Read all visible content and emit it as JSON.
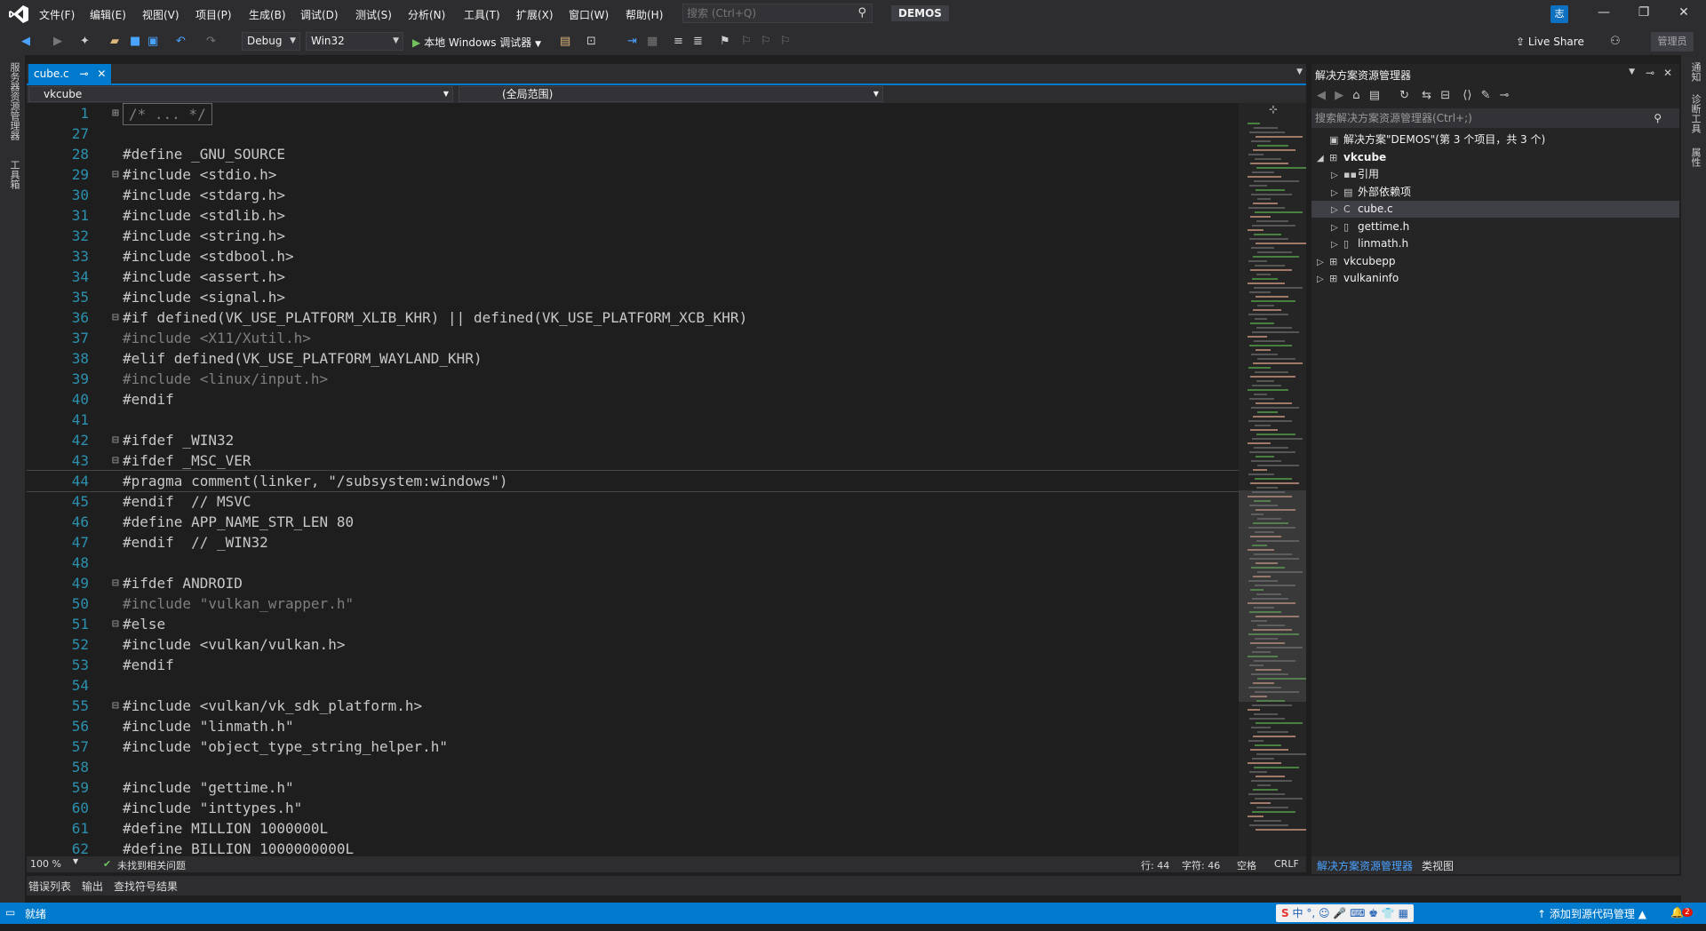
{
  "menu": {
    "items": [
      "文件(F)",
      "编辑(E)",
      "视图(V)",
      "项目(P)",
      "生成(B)",
      "调试(D)",
      "测试(S)",
      "分析(N)",
      "工具(T)",
      "扩展(X)",
      "窗口(W)",
      "帮助(H)"
    ],
    "search_placeholder": "搜索 (Ctrl+Q)",
    "solution_name": "DEMOS",
    "user_initial": "志"
  },
  "toolbar": {
    "config": "Debug",
    "platform": "Win32",
    "run_label": "本地 Windows 调试器",
    "live_share": "Live Share",
    "admin": "管理员"
  },
  "left_strip": {
    "items": [
      "服务器资源管理器",
      "工具箱"
    ]
  },
  "right_strip": {
    "items": [
      "通知",
      "诊断工具",
      "属性"
    ]
  },
  "editor": {
    "tab_name": "cube.c",
    "nav_project": "vkcube",
    "nav_scope": "(全局范围)",
    "lines": [
      {
        "n": "1",
        "fold": "⊞",
        "text": "/* ... */",
        "cls": "dim"
      },
      {
        "n": "27",
        "fold": "",
        "text": "",
        "cls": ""
      },
      {
        "n": "28",
        "fold": "",
        "text": "#define _GNU_SOURCE",
        "cls": "pp"
      },
      {
        "n": "29",
        "fold": "⊟",
        "text": "#include <stdio.h>",
        "cls": "pp"
      },
      {
        "n": "30",
        "fold": "",
        "text": "#include <stdarg.h>",
        "cls": "pp"
      },
      {
        "n": "31",
        "fold": "",
        "text": "#include <stdlib.h>",
        "cls": "pp"
      },
      {
        "n": "32",
        "fold": "",
        "text": "#include <string.h>",
        "cls": "pp"
      },
      {
        "n": "33",
        "fold": "",
        "text": "#include <stdbool.h>",
        "cls": "pp"
      },
      {
        "n": "34",
        "fold": "",
        "text": "#include <assert.h>",
        "cls": "pp"
      },
      {
        "n": "35",
        "fold": "",
        "text": "#include <signal.h>",
        "cls": "pp"
      },
      {
        "n": "36",
        "fold": "⊟",
        "text": "#if defined(VK_USE_PLATFORM_XLIB_KHR) || defined(VK_USE_PLATFORM_XCB_KHR)",
        "cls": "pp"
      },
      {
        "n": "37",
        "fold": "",
        "text": "#include <X11/Xutil.h>",
        "cls": "dim"
      },
      {
        "n": "38",
        "fold": "",
        "text": "#elif defined(VK_USE_PLATFORM_WAYLAND_KHR)",
        "cls": "pp"
      },
      {
        "n": "39",
        "fold": "",
        "text": "#include <linux/input.h>",
        "cls": "dim"
      },
      {
        "n": "40",
        "fold": "",
        "text": "#endif",
        "cls": "pp"
      },
      {
        "n": "41",
        "fold": "",
        "text": "",
        "cls": ""
      },
      {
        "n": "42",
        "fold": "⊟",
        "text": "#ifdef _WIN32",
        "cls": "pp"
      },
      {
        "n": "43",
        "fold": "⊟",
        "text": "#ifdef _MSC_VER",
        "cls": "pp"
      },
      {
        "n": "44",
        "fold": "",
        "text": "#pragma comment(linker, \"/subsystem:windows\")",
        "cls": "pp"
      },
      {
        "n": "45",
        "fold": "",
        "text": "#endif  // MSVC",
        "cls": "pp"
      },
      {
        "n": "46",
        "fold": "",
        "text": "#define APP_NAME_STR_LEN 80",
        "cls": "pp"
      },
      {
        "n": "47",
        "fold": "",
        "text": "#endif  // _WIN32",
        "cls": "pp"
      },
      {
        "n": "48",
        "fold": "",
        "text": "",
        "cls": ""
      },
      {
        "n": "49",
        "fold": "⊟",
        "text": "#ifdef ANDROID",
        "cls": "pp"
      },
      {
        "n": "50",
        "fold": "",
        "text": "#include \"vulkan_wrapper.h\"",
        "cls": "dim"
      },
      {
        "n": "51",
        "fold": "⊟",
        "text": "#else",
        "cls": "pp"
      },
      {
        "n": "52",
        "fold": "",
        "text": "#include <vulkan/vulkan.h>",
        "cls": "pp"
      },
      {
        "n": "53",
        "fold": "",
        "text": "#endif",
        "cls": "pp"
      },
      {
        "n": "54",
        "fold": "",
        "text": "",
        "cls": ""
      },
      {
        "n": "55",
        "fold": "⊟",
        "text": "#include <vulkan/vk_sdk_platform.h>",
        "cls": "pp"
      },
      {
        "n": "56",
        "fold": "",
        "text": "#include \"linmath.h\"",
        "cls": "pp"
      },
      {
        "n": "57",
        "fold": "",
        "text": "#include \"object_type_string_helper.h\"",
        "cls": "pp"
      },
      {
        "n": "58",
        "fold": "",
        "text": "",
        "cls": ""
      },
      {
        "n": "59",
        "fold": "",
        "text": "#include \"gettime.h\"",
        "cls": "pp"
      },
      {
        "n": "60",
        "fold": "",
        "text": "#include \"inttypes.h\"",
        "cls": "pp"
      },
      {
        "n": "61",
        "fold": "",
        "text": "#define MILLION 1000000L",
        "cls": "pp"
      },
      {
        "n": "62",
        "fold": "",
        "text": "#define BILLION 1000000000L",
        "cls": "pp"
      }
    ],
    "zoom": "100 %",
    "issues": "未找到相关问题",
    "row": "行: 44",
    "col": "字符: 46",
    "spaces": "空格",
    "eol": "CRLF"
  },
  "solution_explorer": {
    "title": "解决方案资源管理器",
    "search_placeholder": "搜索解决方案资源管理器(Ctrl+;)",
    "tree": [
      {
        "label": "解决方案\"DEMOS\"(第 3 个项目，共 3 个)",
        "depth": 0,
        "exp": "",
        "icon": "▣",
        "bold": false
      },
      {
        "label": "vkcube",
        "depth": 0,
        "exp": "◢",
        "icon": "⊞",
        "bold": true
      },
      {
        "label": "引用",
        "depth": 1,
        "exp": "▷",
        "icon": "▪▪",
        "bold": false
      },
      {
        "label": "外部依赖项",
        "depth": 1,
        "exp": "▷",
        "icon": "▤",
        "bold": false
      },
      {
        "label": "cube.c",
        "depth": 1,
        "exp": "▷",
        "icon": "C",
        "bold": false
      },
      {
        "label": "gettime.h",
        "depth": 1,
        "exp": "▷",
        "icon": "▯",
        "bold": false
      },
      {
        "label": "linmath.h",
        "depth": 1,
        "exp": "▷",
        "icon": "▯",
        "bold": false
      },
      {
        "label": "vkcubepp",
        "depth": 0,
        "exp": "▷",
        "icon": "⊞",
        "bold": false
      },
      {
        "label": "vulkaninfo",
        "depth": 0,
        "exp": "▷",
        "icon": "⊞",
        "bold": false
      }
    ],
    "tabs": [
      "解决方案资源管理器",
      "类视图"
    ]
  },
  "bottom_tabs": [
    "错误列表",
    "输出",
    "查找符号结果"
  ],
  "status": {
    "ready": "就绪",
    "source_control": "添加到源代码管理",
    "ime": "中",
    "notifications": "2"
  },
  "colors": {
    "accent": "#007acc",
    "background": "#1e1e1e",
    "chrome": "#2d2d30"
  }
}
